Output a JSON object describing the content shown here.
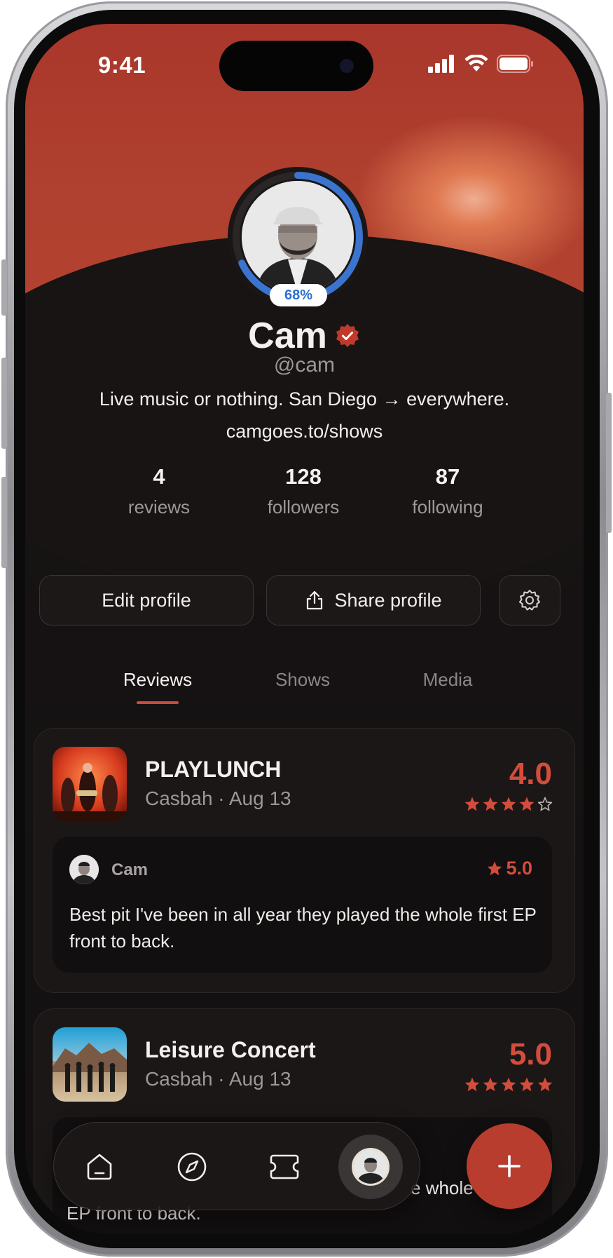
{
  "status_bar": {
    "time": "9:41"
  },
  "profile": {
    "name": "Cam",
    "handle": "@cam",
    "bio": "Live music or nothing. San Diego → everywhere.",
    "link": "camgoes.to/shows",
    "progress_label": "68%",
    "progress": 0.68,
    "verified_icon": "verified-badge-icon"
  },
  "stats": [
    {
      "value": "4",
      "label": "reviews"
    },
    {
      "value": "128",
      "label": "followers"
    },
    {
      "value": "87",
      "label": "following"
    }
  ],
  "actions": {
    "edit": "Edit profile",
    "share": "Share profile",
    "settings_icon": "gear-icon"
  },
  "tabs": [
    {
      "label": "Reviews",
      "active": true
    },
    {
      "label": "Shows",
      "active": false
    },
    {
      "label": "Media",
      "active": false
    }
  ],
  "reviews": [
    {
      "title": "PLAYLUNCH",
      "subtitle": "Casbah · Aug 13",
      "score": "4.0",
      "rating": 4,
      "review": {
        "author": "Cam",
        "score": "5.0",
        "text": "Best pit I've been in all year they played the whole first EP front to back."
      }
    },
    {
      "title": "Leisure Concert",
      "subtitle": "Casbah · Aug 13",
      "score": "5.0",
      "rating": 5,
      "review": {
        "text_fragment_right": "e whole",
        "text_fragment_left": "EP front to back."
      }
    }
  ],
  "nav": {
    "items": [
      "home-icon",
      "compass-icon",
      "ticket-icon",
      "profile-avatar"
    ],
    "fab_icon": "plus-icon"
  },
  "colors": {
    "accent": "#d44c3b",
    "hero": "#b0402f",
    "ring": "#3a74cf",
    "background": "#141112"
  }
}
